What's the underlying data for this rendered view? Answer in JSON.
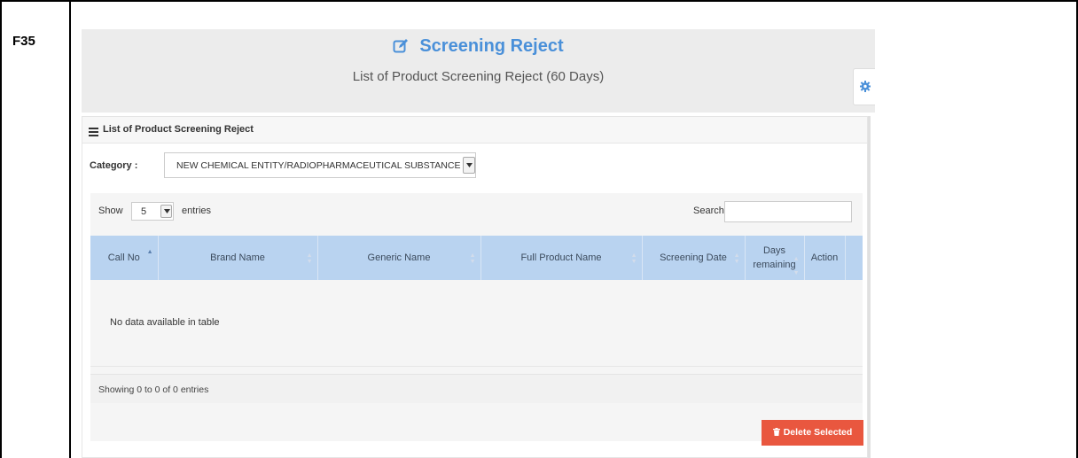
{
  "row_label": "F35",
  "page": {
    "title": "Screening Reject",
    "subtitle": "List of Product Screening Reject (60 Days)",
    "title_color": "#4a90d9"
  },
  "panel": {
    "title": "List of Product Screening Reject",
    "category_label": "Category :",
    "category_value": "NEW CHEMICAL ENTITY/RADIOPHARMACEUTICAL SUBSTANCE"
  },
  "datatable": {
    "show_label": "Show",
    "page_length": "5",
    "entries_label": "entries",
    "search_label": "Search:",
    "search_value": "",
    "columns": [
      "Call No",
      "Brand Name",
      "Generic Name",
      "Full Product Name",
      "Screening Date",
      "Days remaining",
      "Action"
    ],
    "sorted_column": "Call No",
    "empty_message": "No data available in table",
    "info": "Showing 0 to 0 of 0 entries",
    "header_color": "#b9d3f0"
  },
  "actions": {
    "delete_selected_label": "Delete Selected",
    "delete_color": "#e9573f"
  },
  "icons": {
    "title": "edit-icon",
    "panel": "list-icon",
    "settings": "gear-icon",
    "delete": "trash-icon"
  }
}
